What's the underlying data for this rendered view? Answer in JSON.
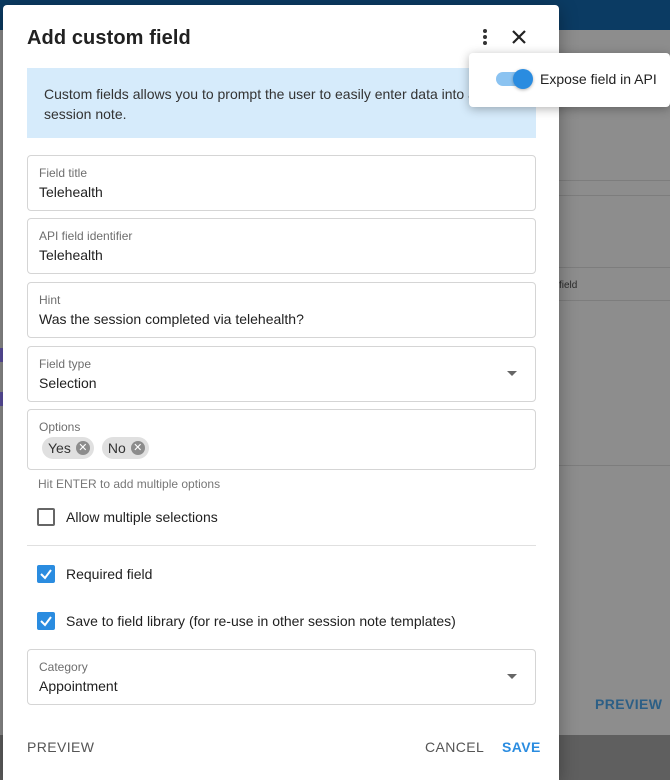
{
  "background": {
    "preview_label": "PREVIEW",
    "field_fragment": "field"
  },
  "dialog": {
    "title": "Add custom field",
    "info_text": "Custom fields allows you to prompt the user to easily enter data into a session note.",
    "fields": {
      "field_title": {
        "label": "Field title",
        "value": "Telehealth"
      },
      "api_identifier": {
        "label": "API field identifier",
        "value": "Telehealth"
      },
      "hint": {
        "label": "Hint",
        "value": "Was the session completed via telehealth?"
      },
      "field_type": {
        "label": "Field type",
        "value": "Selection"
      },
      "options": {
        "label": "Options",
        "chips": [
          "Yes",
          "No"
        ]
      },
      "category": {
        "label": "Category",
        "value": "Appointment"
      }
    },
    "options_helper": "Hit ENTER to add multiple options",
    "checkboxes": {
      "allow_multiple": {
        "label": "Allow multiple selections",
        "checked": false
      },
      "required": {
        "label": "Required field",
        "checked": true
      },
      "save_library": {
        "label": "Save to field library (for re-use in other session note templates)",
        "checked": true
      }
    },
    "actions": {
      "preview": "PREVIEW",
      "cancel": "CANCEL",
      "save": "SAVE"
    }
  },
  "popover": {
    "expose_label": "Expose field in API",
    "expose_on": true
  },
  "colors": {
    "accent": "#2a8ce0",
    "info_bg": "#d6ebfb",
    "header_bar": "#0b3b63"
  },
  "icons": {
    "menu": "more-vert-icon",
    "close": "close-icon",
    "chip_remove": "chip-remove-icon",
    "dropdown": "chevron-down-icon",
    "check": "check-icon"
  }
}
